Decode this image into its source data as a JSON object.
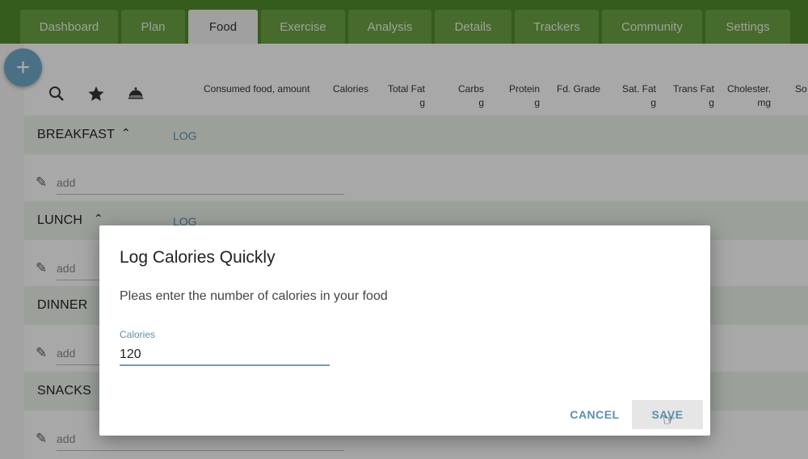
{
  "nav": {
    "tabs": [
      {
        "label": "Dashboard"
      },
      {
        "label": "Plan"
      },
      {
        "label": "Food"
      },
      {
        "label": "Exercise"
      },
      {
        "label": "Analysis"
      },
      {
        "label": "Details"
      },
      {
        "label": "Trackers"
      },
      {
        "label": "Community"
      },
      {
        "label": "Settings"
      }
    ],
    "active": "Food"
  },
  "fab": {
    "label": "+"
  },
  "toolbar": {
    "icons": [
      "search-icon",
      "star-icon",
      "cloche-icon"
    ]
  },
  "columns": [
    {
      "label": "Consumed food, amount",
      "unit": ""
    },
    {
      "label": "Calories",
      "unit": ""
    },
    {
      "label": "Total Fat",
      "unit": "g"
    },
    {
      "label": "Carbs",
      "unit": "g"
    },
    {
      "label": "Protein",
      "unit": "g"
    },
    {
      "label": "Fd. Grade",
      "unit": ""
    },
    {
      "label": "Sat. Fat",
      "unit": "g"
    },
    {
      "label": "Trans Fat",
      "unit": "g"
    },
    {
      "label": "Cholester.",
      "unit": "mg"
    },
    {
      "label": "So",
      "unit": ""
    }
  ],
  "meals": [
    {
      "title": "BREAKFAST",
      "log": "LOG",
      "add": "add"
    },
    {
      "title": "LUNCH",
      "log": "LOG",
      "add": "add"
    },
    {
      "title": "DINNER",
      "log": "",
      "add": "add"
    },
    {
      "title": "SNACKS",
      "log": "",
      "add": "add"
    }
  ],
  "dialog": {
    "title": "Log Calories Quickly",
    "message": "Pleas enter the number of calories in your food",
    "field_label": "Calories",
    "field_value": "120",
    "cancel": "CANCEL",
    "save": "SAVE"
  },
  "colors": {
    "nav_bg": "#4f8a2a",
    "tab_bg": "#6a9f44",
    "accent": "#5b8fb0",
    "fab": "#6fa7c6"
  }
}
